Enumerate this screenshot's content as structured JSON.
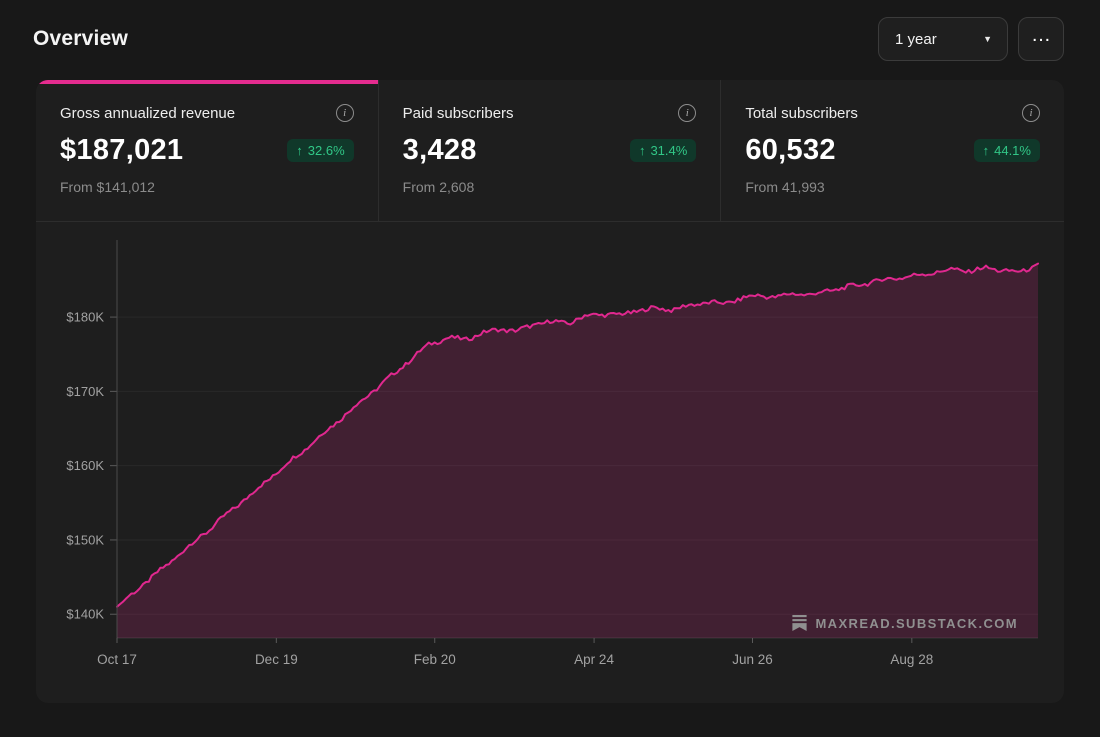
{
  "page_title": "Overview",
  "controls": {
    "range_value": "1 year",
    "caret_icon": "▼",
    "more_icon": "…"
  },
  "icons": {
    "up_arrow": "↑",
    "info": "i"
  },
  "stats": [
    {
      "label": "Gross annualized revenue",
      "value": "$187,021",
      "change": "32.6%",
      "from": "From $141,012"
    },
    {
      "label": "Paid subscribers",
      "value": "3,428",
      "change": "31.4%",
      "from": "From 2,608"
    },
    {
      "label": "Total subscribers",
      "value": "60,532",
      "change": "44.1%",
      "from": "From 41,993"
    }
  ],
  "watermark": "MAXREAD.SUBSTACK.COM",
  "colors": {
    "accent": "#e52c8f",
    "line": "#e0288f",
    "fill": "rgba(229,44,143,0.18)",
    "badge_bg": "#10382a",
    "badge_text": "#31c787"
  },
  "chart_data": {
    "type": "area",
    "title": "",
    "ylabel": "",
    "xlabel": "",
    "unit": "USD (thousands)",
    "ylim": [
      136.8,
      189.3
    ],
    "grid": true,
    "yticks": [
      {
        "value": 140,
        "label": "$140K"
      },
      {
        "value": 150,
        "label": "$150K"
      },
      {
        "value": 160,
        "label": "$160K"
      },
      {
        "value": 170,
        "label": "$170K"
      },
      {
        "value": 180,
        "label": "$180K"
      }
    ],
    "x_labels": [
      {
        "pos": 0.0,
        "label": "Oct 17"
      },
      {
        "pos": 0.173,
        "label": "Dec 19"
      },
      {
        "pos": 0.345,
        "label": "Feb 20"
      },
      {
        "pos": 0.518,
        "label": "Apr 24"
      },
      {
        "pos": 0.69,
        "label": "Jun 26"
      },
      {
        "pos": 0.863,
        "label": "Aug 28"
      }
    ],
    "values": [
      141.0,
      143.0,
      144.9,
      146.9,
      148.9,
      150.8,
      152.8,
      154.8,
      156.7,
      158.7,
      160.7,
      162.6,
      164.6,
      166.6,
      168.6,
      170.5,
      172.5,
      174.5,
      176.4,
      177.2,
      177.0,
      177.8,
      178.4,
      178.1,
      179.0,
      179.4,
      179.2,
      180.2,
      180.4,
      180.3,
      180.9,
      181.2,
      181.0,
      181.6,
      182.0,
      181.8,
      182.6,
      182.9,
      182.7,
      183.2,
      183.0,
      183.6,
      184.0,
      184.5,
      185.0,
      185.3,
      185.6,
      186.0,
      186.4,
      186.2,
      186.6,
      186.3,
      186.0,
      187.2
    ],
    "line_color": "#e0288f",
    "fill_color": "rgba(229,44,143,0.18)"
  }
}
